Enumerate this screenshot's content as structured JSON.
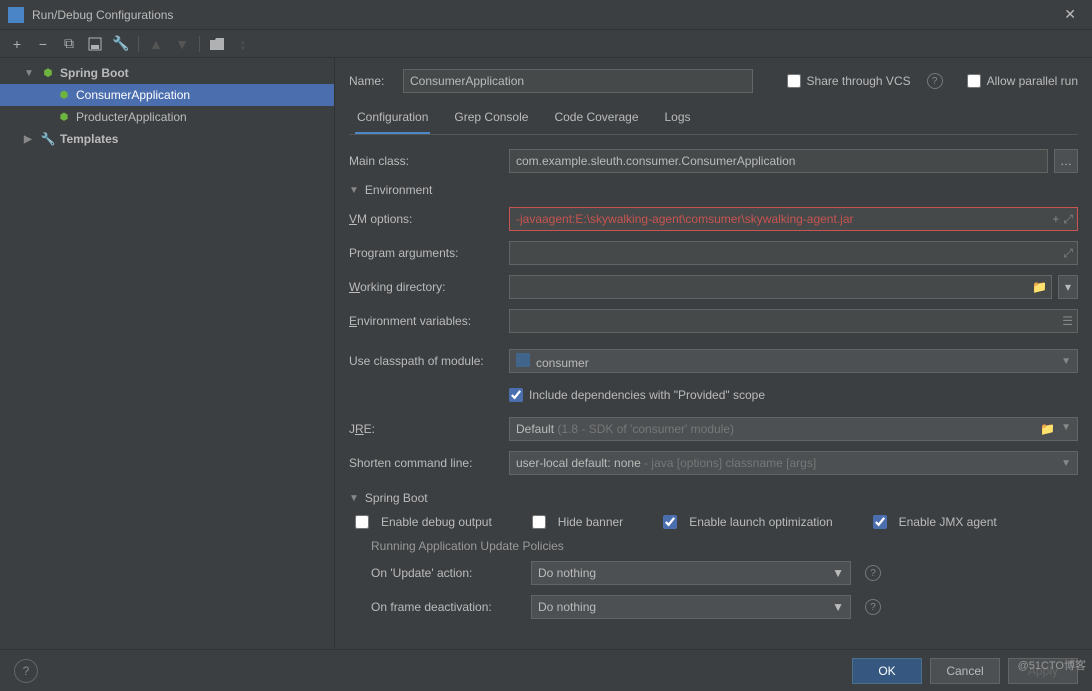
{
  "titlebar": {
    "title": "Run/Debug Configurations"
  },
  "toolbar": {
    "add": "+",
    "remove": "−",
    "copy": "⿻",
    "save": "💾",
    "wrench": "🔧",
    "up": "▲",
    "down": "▼",
    "folder": "📁",
    "restore": "↺"
  },
  "tree": {
    "spring_boot": "Spring Boot",
    "consumer": "ConsumerApplication",
    "producter": "ProducterApplication",
    "templates": "Templates"
  },
  "header": {
    "name_label": "Name:",
    "name_value": "ConsumerApplication",
    "share_label": "Share through VCS",
    "parallel_label": "Allow parallel run"
  },
  "tabs": {
    "config": "Configuration",
    "grep": "Grep Console",
    "coverage": "Code Coverage",
    "logs": "Logs"
  },
  "form": {
    "main_class_label": "Main class:",
    "main_class_value": "com.example.sleuth.consumer.ConsumerApplication",
    "env_section": "Environment",
    "vm_label": "VM options:",
    "vm_value": "-javaagent:E:\\skywalking-agent\\comsumer\\skywalking-agent.jar",
    "prog_args_label": "Program arguments:",
    "prog_args_value": "",
    "work_dir_label": "Working directory:",
    "work_dir_value": "",
    "env_vars_label": "Environment variables:",
    "env_vars_value": "",
    "classpath_label": "Use classpath of module:",
    "classpath_value": "consumer",
    "include_deps": "Include dependencies with \"Provided\" scope",
    "jre_label": "JRE:",
    "jre_value_prefix": "Default",
    "jre_value_suffix": " (1.8 - SDK of 'consumer' module)",
    "shorten_label": "Shorten command line:",
    "shorten_value_prefix": "user-local default: none",
    "shorten_value_suffix": " - java [options] classname [args]",
    "sb_section": "Spring Boot",
    "enable_debug": "Enable debug output",
    "hide_banner": "Hide banner",
    "enable_launch": "Enable launch optimization",
    "enable_jmx": "Enable JMX agent",
    "running_policies": "Running Application Update Policies",
    "on_update_label": "On 'Update' action:",
    "on_update_value": "Do nothing",
    "on_frame_label": "On frame deactivation:",
    "on_frame_value": "Do nothing"
  },
  "buttons": {
    "ok": "OK",
    "cancel": "Cancel",
    "apply": "Apply"
  },
  "watermark": "@51CTO博客"
}
